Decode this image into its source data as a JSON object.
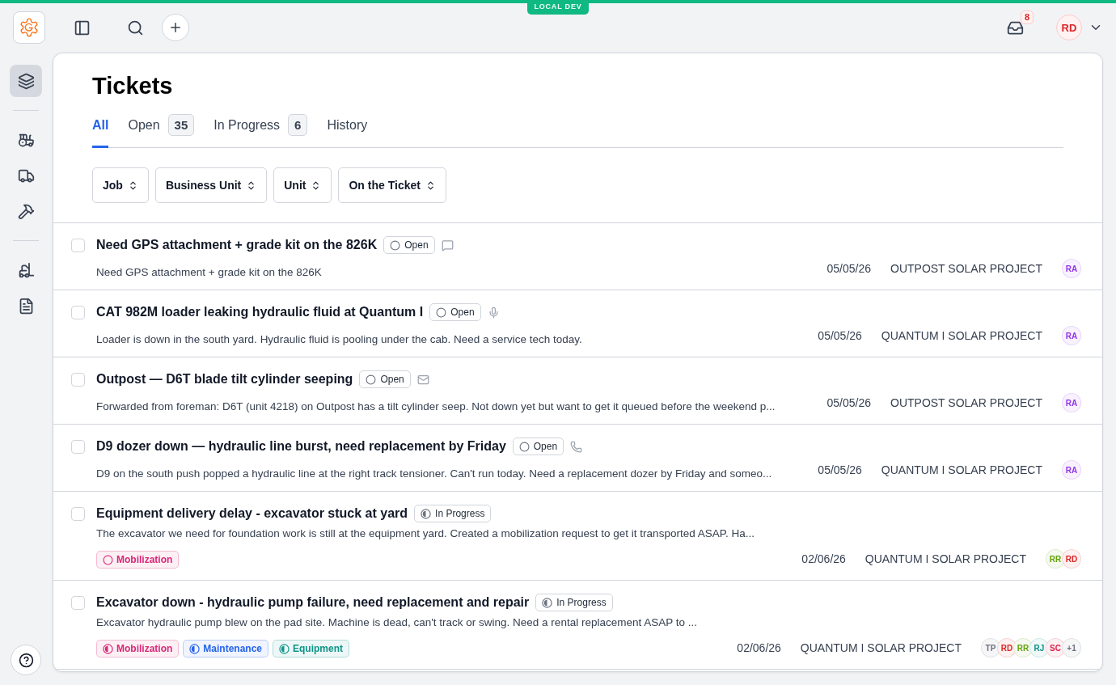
{
  "env_badge": "LOCAL DEV",
  "topbar": {
    "notifications": "8",
    "user": {
      "initials": "RD",
      "color": "#dc2626"
    }
  },
  "sidebar": {
    "items": [
      {
        "selected": true
      },
      {
        "selected": false
      },
      {
        "selected": false
      },
      {
        "selected": false
      },
      {
        "selected": false
      },
      {
        "selected": false
      }
    ]
  },
  "page": {
    "title": "Tickets"
  },
  "tabs": [
    {
      "label": "All",
      "selected": true
    },
    {
      "label": "Open",
      "count": "35",
      "selected": false
    },
    {
      "label": "In Progress",
      "count": "6",
      "selected": false
    },
    {
      "label": "History",
      "selected": false
    }
  ],
  "filters": [
    "Job",
    "Business Unit",
    "Unit",
    "On the Ticket"
  ],
  "tickets": [
    {
      "title": "Need GPS attachment + grade kit on the 826K",
      "status": {
        "kind": "open",
        "label": "Open"
      },
      "kind": "message",
      "description": "Need GPS attachment + grade kit on the 826K",
      "checked": false,
      "date": "05/05/26",
      "project": "OUTPOST SOLAR PROJECT",
      "assignees": [
        {
          "initials": "RA",
          "color": "#9333ea"
        }
      ]
    },
    {
      "title": "CAT 982M loader leaking hydraulic fluid at Quantum I",
      "status": {
        "kind": "open",
        "label": "Open"
      },
      "kind": "voice",
      "description": "Loader is down in the south yard. Hydraulic fluid is pooling under the cab. Need a service tech today.",
      "checked": false,
      "date": "05/05/26",
      "project": "QUANTUM I SOLAR PROJECT",
      "assignees": [
        {
          "initials": "RA",
          "color": "#9333ea"
        }
      ]
    },
    {
      "title": "Outpost — D6T blade tilt cylinder seeping",
      "status": {
        "kind": "open",
        "label": "Open"
      },
      "kind": "email",
      "description": "Forwarded from foreman: D6T (unit 4218) on Outpost has a tilt cylinder seep. Not down yet but want to get it queued before the weekend p...",
      "checked": false,
      "date": "05/05/26",
      "project": "OUTPOST SOLAR PROJECT",
      "assignees": [
        {
          "initials": "RA",
          "color": "#9333ea"
        }
      ]
    },
    {
      "title": "D9 dozer down — hydraulic line burst, need replacement by Friday",
      "status": {
        "kind": "open",
        "label": "Open"
      },
      "kind": "phone",
      "description": "D9 on the south push popped a hydraulic line at the right track tensioner. Can't run today. Need a replacement dozer by Friday and someo...",
      "checked": false,
      "date": "05/05/26",
      "project": "QUANTUM I SOLAR PROJECT",
      "assignees": [
        {
          "initials": "RA",
          "color": "#9333ea"
        }
      ]
    },
    {
      "title": "Equipment delivery delay - excavator stuck at yard",
      "status": {
        "kind": "in_progress",
        "label": "In Progress"
      },
      "description": "The excavator we need for foundation work is still at the equipment yard. Created a mobilization request to get it transported ASAP. Ha...",
      "checked": false,
      "tags": [
        {
          "label": "Mobilization",
          "color": "#db2777",
          "kind": "open"
        }
      ],
      "date": "02/06/26",
      "project": "QUANTUM I SOLAR PROJECT",
      "assignees": [
        {
          "initials": "RR",
          "color": "#65a30d"
        },
        {
          "initials": "RD",
          "color": "#dc2626"
        }
      ]
    },
    {
      "title": "Excavator down - hydraulic pump failure, need replacement and repair",
      "status": {
        "kind": "in_progress",
        "label": "In Progress"
      },
      "description": "Excavator hydraulic pump blew on the pad site. Machine is dead, can't track or swing. Need a rental replacement ASAP to ...",
      "checked": false,
      "tags": [
        {
          "label": "Mobilization",
          "color": "#db2777",
          "kind": "in_progress"
        },
        {
          "label": "Maintenance",
          "color": "#2563eb",
          "kind": "in_progress"
        },
        {
          "label": "Equipment",
          "color": "#0d9488",
          "kind": "in_progress"
        }
      ],
      "date": "02/06/26",
      "project": "QUANTUM I SOLAR PROJECT",
      "assignees": [
        {
          "initials": "TP",
          "color": "#6b7280"
        },
        {
          "initials": "RD",
          "color": "#dc2626"
        },
        {
          "initials": "RR",
          "color": "#65a30d"
        },
        {
          "initials": "RJ",
          "color": "#0d9488"
        },
        {
          "initials": "SC",
          "color": "#e11d48"
        },
        {
          "initials": "+1",
          "color": "#6b7280"
        }
      ]
    }
  ]
}
